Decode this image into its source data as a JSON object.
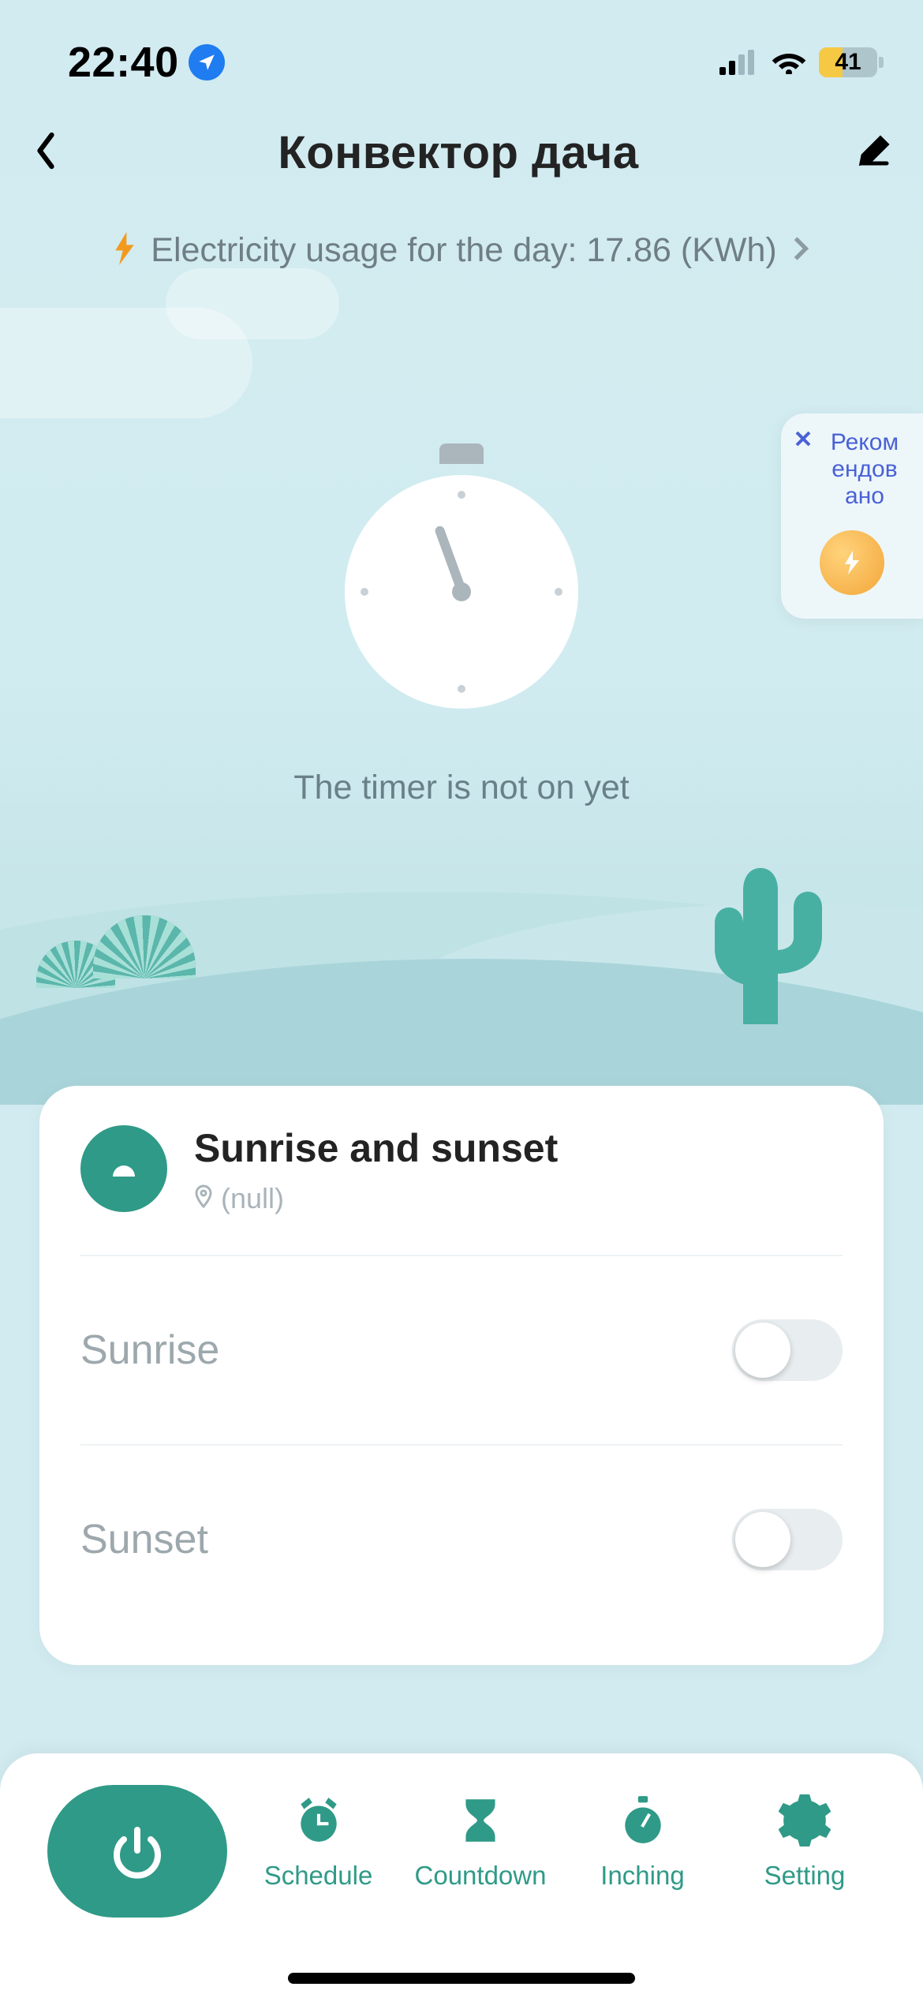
{
  "status": {
    "time": "22:40",
    "battery": "41"
  },
  "header": {
    "title": "Конвектор дача"
  },
  "usage": {
    "label": "Electricity usage for the day: 17.86 (KWh)"
  },
  "timer": {
    "status_text": "The timer is not on yet"
  },
  "recommend": {
    "label": "Реком ендов ано"
  },
  "card": {
    "title": "Sunrise and sunset",
    "location": "(null)",
    "rows": [
      {
        "label": "Sunrise"
      },
      {
        "label": "Sunset"
      }
    ]
  },
  "bottom": {
    "items": [
      {
        "label": "Schedule"
      },
      {
        "label": "Countdown"
      },
      {
        "label": "Inching"
      },
      {
        "label": "Setting"
      }
    ]
  }
}
